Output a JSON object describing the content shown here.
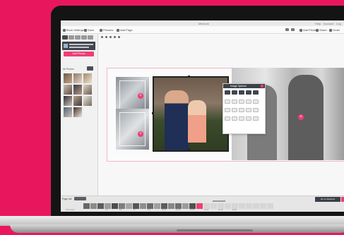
{
  "window": {
    "title": "Mixbook"
  },
  "titlebar_right": [
    "Help",
    "Account",
    "Log out"
  ],
  "toolbar": {
    "items": [
      "Book Settings",
      "Save",
      "Preview",
      "Add Page"
    ],
    "right_items": [
      "Undo",
      "Redo",
      "Add Photo",
      "Share",
      "Order"
    ]
  },
  "left_panel": {
    "notice_lines": [
      "",
      ""
    ],
    "add_photos_button": "Add Photos",
    "filter_label": "All Photos"
  },
  "image_options": {
    "title": "Image Options"
  },
  "bottom_bar": {
    "label": "Page list",
    "order_button": "Go to checkout",
    "page_numbers": [
      "Front cover",
      "2-3",
      "4-5",
      "6-7",
      "8-9",
      "10-11",
      "12-13",
      "14-15",
      "16-17",
      "18-19",
      "20-21"
    ]
  },
  "colors": {
    "brand_pink": "#ee3f72",
    "background": "#e8175d",
    "dark_panel": "#3c4149"
  }
}
